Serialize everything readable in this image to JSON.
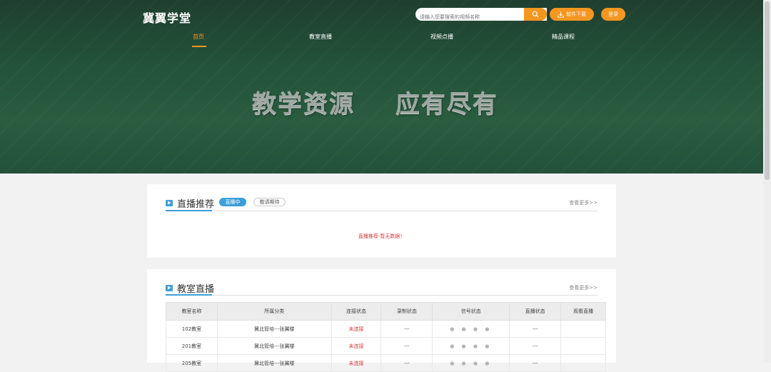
{
  "header": {
    "logo": "冀翼学堂",
    "search_placeholder": "请输入您要搜索的视频名称",
    "download_label": "软件下载",
    "login_label": "登录"
  },
  "nav": [
    {
      "label": "首页",
      "active": true
    },
    {
      "label": "教室直播",
      "active": false
    },
    {
      "label": "视频点播",
      "active": false
    },
    {
      "label": "精品课程",
      "active": false
    }
  ],
  "hero": {
    "slogan_left": "教学资源",
    "slogan_right": "应有尽有"
  },
  "live_section": {
    "title": "直播推荐",
    "tab_live": "直播中",
    "tab_upcoming": "敬请期待",
    "more": "查看更多>>",
    "empty": "直播推荐-暂无数据！"
  },
  "classroom_section": {
    "title": "教室直播",
    "more": "查看更多>>",
    "columns": [
      "教室名称",
      "所属分类",
      "连接状态",
      "录制状态",
      "信号状态",
      "直播状态",
      "观看直播"
    ],
    "rows": [
      [
        "102教室",
        "冀北管培---张翼楼",
        "未连接",
        "---",
        "● ● ● ●",
        "---",
        ""
      ],
      [
        "201教室",
        "冀北管培---张翼楼",
        "未连接",
        "---",
        "● ● ● ●",
        "---",
        ""
      ],
      [
        "205教室",
        "冀北管培---张翼楼",
        "未连接",
        "---",
        "● ● ● ●",
        "---",
        ""
      ]
    ]
  },
  "colors": {
    "accent": "#f5961f",
    "blue": "#3d9fd8",
    "hero_green": "#23543a",
    "alert_red": "#d13b3b"
  }
}
